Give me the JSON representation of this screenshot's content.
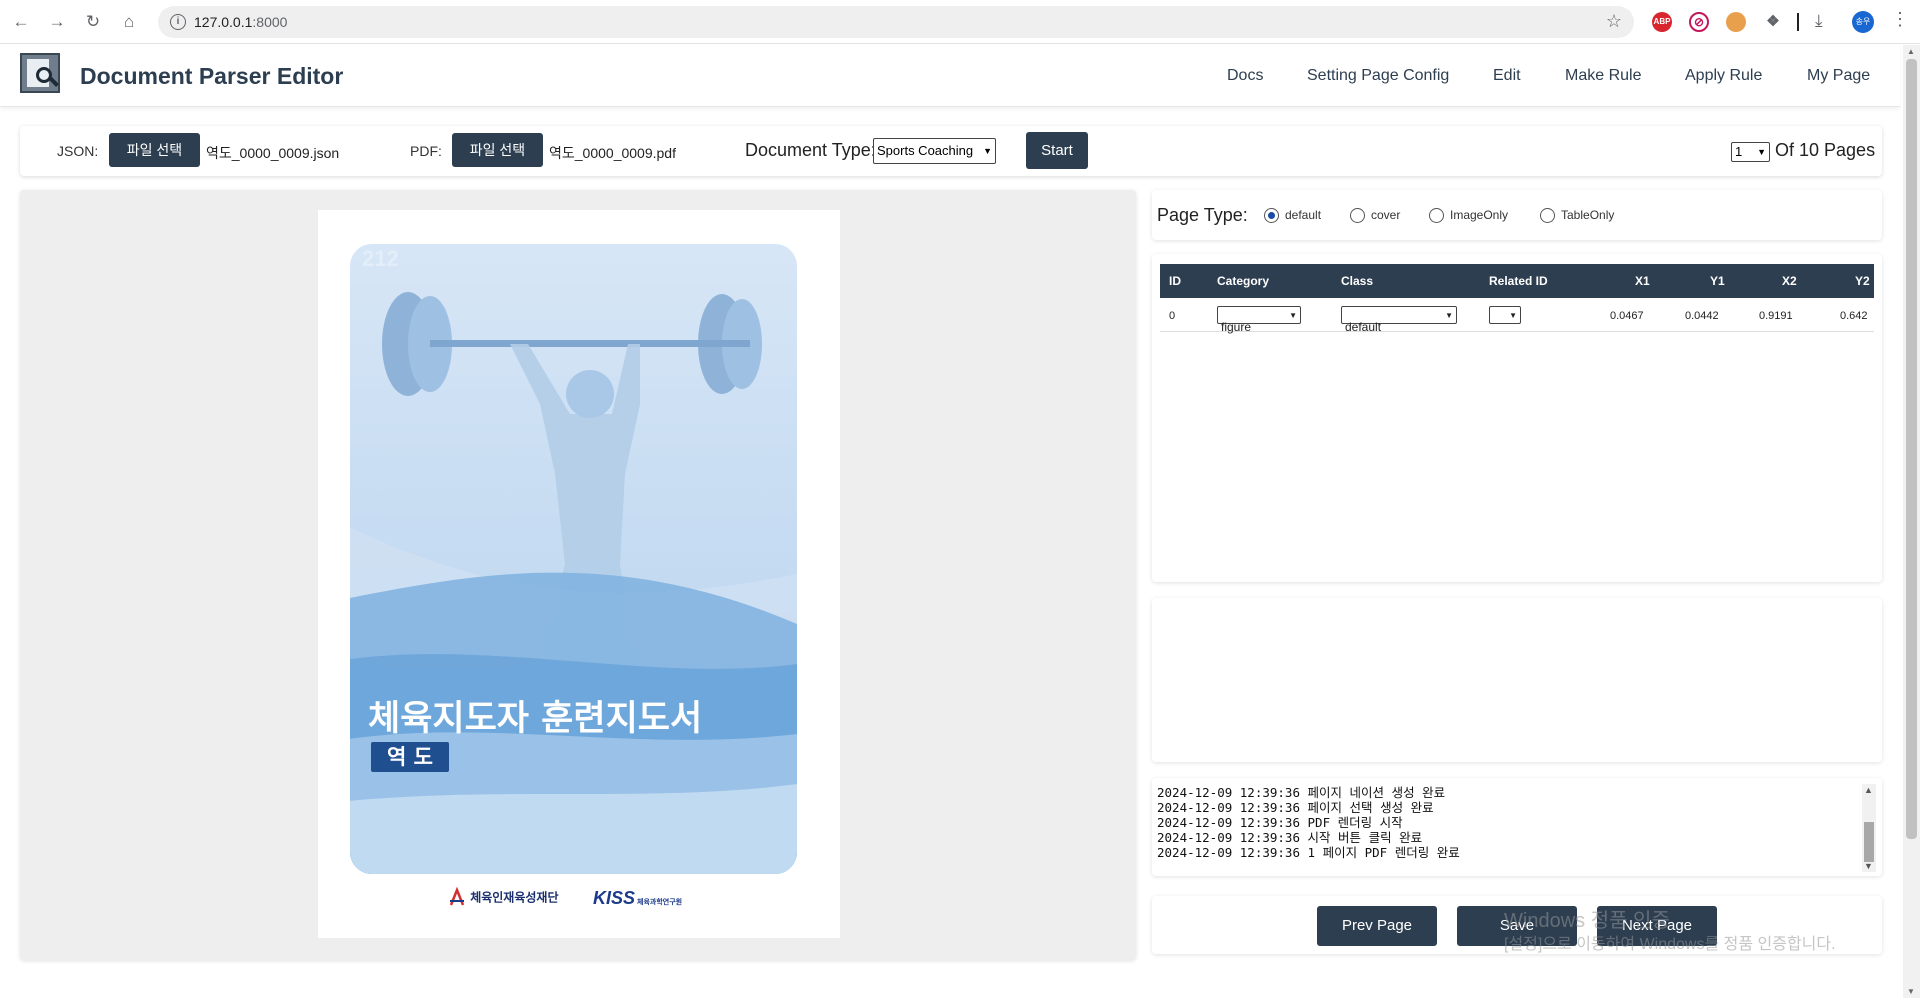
{
  "browser": {
    "url_host": "127.0.0.1",
    "url_port": ":8000",
    "icons": [
      "back-icon",
      "forward-icon",
      "reload-icon",
      "home-icon",
      "info-icon",
      "star-icon",
      "abp-icon",
      "block-icon",
      "extension-icon",
      "puzzle-icon",
      "download-icon",
      "menu-icon"
    ],
    "abp_label": "ABP",
    "profile_label": "송우"
  },
  "header": {
    "title": "Document Parser Editor",
    "nav": [
      "Docs",
      "Setting Page Config",
      "Edit",
      "Make Rule",
      "Apply Rule",
      "My Page"
    ]
  },
  "toolbar": {
    "json_label": "JSON:",
    "json_button": "파일 선택",
    "json_file": "역도_0000_0009.json",
    "pdf_label": "PDF:",
    "pdf_button": "파일 선택",
    "pdf_file": "역도_0000_0009.pdf",
    "doc_type_label": "Document Type:",
    "doc_type_value": "Sports Coaching",
    "start_button": "Start",
    "page_value": "1",
    "page_total": "Of 10 Pages"
  },
  "cover": {
    "number": "212",
    "headline": "체육지도자 훈련지도서",
    "subtitle": "역 도",
    "org1": "체육인재육성재단",
    "org2": "KISS",
    "org2_sub": "체육과학연구원"
  },
  "page_type": {
    "label": "Page Type:",
    "options": [
      "default",
      "cover",
      "ImageOnly",
      "TableOnly"
    ],
    "selected": "default"
  },
  "bbox_table": {
    "headers": [
      "ID",
      "Category",
      "Class",
      "Related ID",
      "X1",
      "Y1",
      "X2",
      "Y2"
    ],
    "rows": [
      {
        "id": "0",
        "category": "figure",
        "class": "default",
        "related_id": "",
        "x1": "0.0467",
        "y1": "0.0442",
        "x2": "0.9191",
        "y2": "0.642"
      }
    ]
  },
  "log": [
    "2024-12-09 12:39:36 페이지 네이션 생성 완료",
    "2024-12-09 12:39:36 페이지 선택 생성 완료",
    "2024-12-09 12:39:36 PDF 렌더링 시작",
    "2024-12-09 12:39:36 시작 버튼 클릭 완료",
    "2024-12-09 12:39:36 1 페이지 PDF 렌더링 완료"
  ],
  "actions": {
    "prev": "Prev Page",
    "save": "Save",
    "next": "Next Page"
  },
  "watermark": {
    "line1": "Windows 정품 인증",
    "line2": "[설정]으로 이동하여 Windows를 정품 인증합니다."
  },
  "colors": {
    "primary": "#2c3e50",
    "radio_accent": "#1a4aa3",
    "cover_blue": "#1f4f8f"
  }
}
